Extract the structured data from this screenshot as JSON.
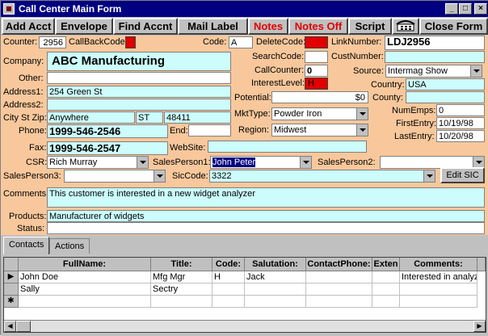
{
  "window": {
    "title": "Call Center Main Form"
  },
  "toolbar": {
    "add_acct": "Add Acct",
    "envelope": "Envelope",
    "find_accnt": "Find Accnt",
    "mail_label": "Mail Label",
    "notes": "Notes",
    "notes_off": "Notes Off",
    "script": "Script",
    "close_form": "Close Form"
  },
  "labels": {
    "counter": "Counter:",
    "callback": "CallBackCode:",
    "code": "Code:",
    "delete": "DeleteCode:",
    "link": "LinkNumber:",
    "company": "Company:",
    "search": "SearchCode:",
    "cust": "CustNumber:",
    "other": "Other:",
    "callcounter": "CallCounter:",
    "source": "Source:",
    "address1": "Address1:",
    "interest": "InterestLevel:",
    "country": "Country:",
    "address2": "Address2:",
    "potential": "Potential:",
    "county": "County:",
    "cityst": "City St Zip:",
    "numemps": "NumEmps:",
    "mkttype": "MktType:",
    "firstentry": "FirstEntry:",
    "phone": "Phone:",
    "end": "End:",
    "region": "Region:",
    "lastentry": "LastEntry:",
    "fax": "Fax:",
    "website": "WebSite:",
    "csr": "CSR:",
    "sp1": "SalesPerson1:",
    "sp2": "SalesPerson2:",
    "sp3": "SalesPerson3:",
    "sic": "SicCode:",
    "comments": "Comments:",
    "products": "Products:",
    "status": "Status:"
  },
  "fields": {
    "counter": "2956",
    "code": "A",
    "link": "LDJ2956",
    "company": "ABC Manufacturing",
    "callcounter": "0",
    "interest": "H",
    "source": "Intermag Show",
    "address1": "254 Green St",
    "country": "USA",
    "potential": "$0",
    "city": "Anywhere",
    "state": "ST",
    "zip": "48411",
    "numemps": "0",
    "mkttype": "Powder Iron",
    "firstentry": "10/19/98",
    "phone": "1999-546-2546",
    "region": "Midwest",
    "lastentry": "10/20/98",
    "fax": "1999-546-2547",
    "csr": "Rich Murray",
    "sp1": "John Peter",
    "sic": "3322",
    "comments": "This customer is interested in a new widget analyzer",
    "products": "Manufacturer of widgets"
  },
  "buttons": {
    "edit_sic": "Edit SIC"
  },
  "tabs": [
    "Contacts",
    "Actions"
  ],
  "contacts": {
    "columns": [
      "FullName:",
      "Title:",
      "Code:",
      "Salutation:",
      "ContactPhone:",
      "Exten",
      "Comments:"
    ],
    "rows": [
      [
        "John Doe",
        "Mfg Mgr",
        "H",
        "Jack",
        "",
        "",
        "Interested in analyz"
      ],
      [
        "Sally",
        "Sectry",
        "",
        "",
        "",
        "",
        ""
      ]
    ]
  },
  "colors": {
    "form_bg": "#f8c89c",
    "field_bg": "#ccfcfc",
    "title_bg": "#000080",
    "alert_red": "#e00000"
  }
}
